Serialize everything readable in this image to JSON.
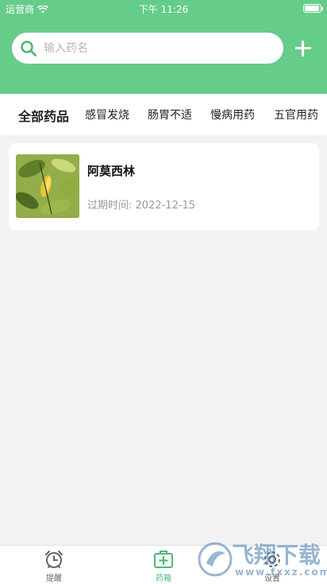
{
  "status_bar": {
    "carrier": "运营商",
    "time": "下午 11:26"
  },
  "search": {
    "placeholder": "输入药名",
    "value": ""
  },
  "categories": [
    {
      "label": "全部药品",
      "active": true
    },
    {
      "label": "感冒发烧",
      "active": false
    },
    {
      "label": "肠胃不适",
      "active": false
    },
    {
      "label": "慢病用药",
      "active": false
    },
    {
      "label": "五官用药",
      "active": false
    }
  ],
  "medicines": [
    {
      "name": "阿莫西林",
      "expiry_label": "过期时间:",
      "expiry_date": "2022-12-15",
      "thumbnail": "green-leaves-photo"
    }
  ],
  "tabbar": {
    "items": [
      {
        "label": "提醒",
        "icon": "alarm-clock-icon",
        "active": false
      },
      {
        "label": "药箱",
        "icon": "medicine-box-icon",
        "active": true
      },
      {
        "label": "设置",
        "icon": "settings-icon",
        "active": false
      }
    ]
  },
  "watermark": {
    "text": "飞翔下载",
    "sub": "www.fxxz.com"
  },
  "colors": {
    "brand": "#66cc8a",
    "active_tab": "#4cb974",
    "background": "#f2f2f2"
  }
}
